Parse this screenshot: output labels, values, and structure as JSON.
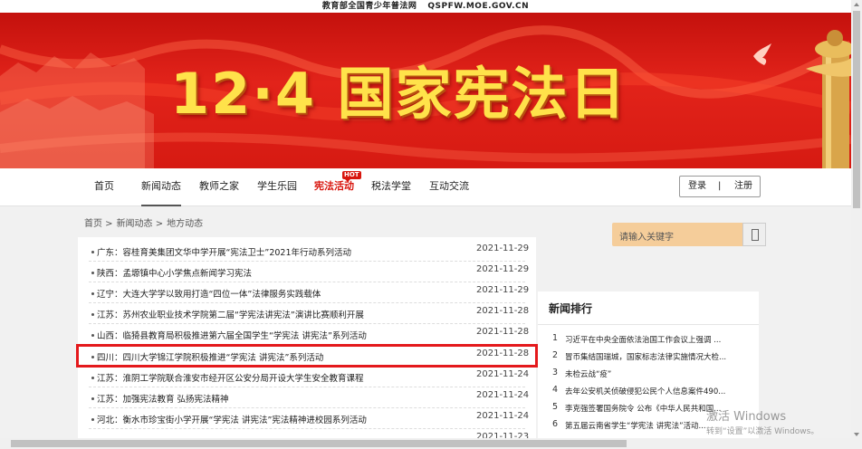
{
  "site": {
    "name": "教育部全国青少年普法网",
    "domain": "QSPFW.MOE.GOV.CN"
  },
  "banner": {
    "title": "12·4 国家宪法日"
  },
  "nav": {
    "items": [
      {
        "label": "首页"
      },
      {
        "label": "新闻动态"
      },
      {
        "label": "教师之家"
      },
      {
        "label": "学生乐园"
      },
      {
        "label": "宪法活动"
      },
      {
        "label": "税法学堂"
      },
      {
        "label": "互动交流"
      }
    ],
    "hot_badge": "HOT",
    "login": "登录",
    "separator": "|",
    "register": "注册"
  },
  "breadcrumb": {
    "home": "首页 >",
    "news": "新闻动态 >",
    "local": "地方动态"
  },
  "news_list": [
    {
      "title": "广东：容桂育美集团文华中学开展“宪法卫士”2021年行动系列活动",
      "date": "2021-11-29"
    },
    {
      "title": "陕西：孟塬镇中心小学焦点新闻学习宪法",
      "date": "2021-11-29"
    },
    {
      "title": "辽宁：大连大学学以致用打造“四位一体”法律服务实践载体",
      "date": "2021-11-29"
    },
    {
      "title": "江苏：苏州农业职业技术学院第二届“学宪法讲宪法”演讲比赛顺利开展",
      "date": "2021-11-28"
    },
    {
      "title": "山西：临猗县教育局积极推进第六届全国学生“学宪法 讲宪法”系列活动",
      "date": "2021-11-28"
    },
    {
      "title": "四川：四川大学锦江学院积极推进“学宪法 讲宪法”系列活动",
      "date": "2021-11-28"
    },
    {
      "title": "江苏：淮阴工学院联合淮安市经开区公安分局开设大学生安全教育课程",
      "date": "2021-11-24"
    },
    {
      "title": "江苏：加强宪法教育 弘扬宪法精神",
      "date": "2021-11-24"
    },
    {
      "title": "河北：衡水市珍宝街小学开展“学宪法 讲宪法”宪法精神进校园系列活动",
      "date": "2021-11-24"
    },
    {
      "title": "",
      "date": "2021-11-23"
    }
  ],
  "search": {
    "placeholder": "请输入关键字"
  },
  "ranking": {
    "heading": "新闻排行",
    "items": [
      {
        "num": "1",
        "title": "习近平在中央全面依法治国工作会议上强调 ..."
      },
      {
        "num": "2",
        "title": "冒币集结国瑞城，国家标志法律实施情况大检..."
      },
      {
        "num": "3",
        "title": "未检云战“疫”"
      },
      {
        "num": "4",
        "title": "去年公安机关侦破侵犯公民个人信息案件490..."
      },
      {
        "num": "5",
        "title": "李克强签署国务院令 公布《中华人民共和国..."
      },
      {
        "num": "6",
        "title": "第五届云南省学生“学宪法 讲宪法”活动..."
      }
    ]
  },
  "watermark": {
    "line1": "激活 Windows",
    "line2": "转到“设置”以激活 Windows。"
  },
  "colors": {
    "brand_red": "#d8160e",
    "banner_gold": "#ffe24a",
    "highlight_box": "#e4191c",
    "search_bg": "#f5cd9a"
  }
}
